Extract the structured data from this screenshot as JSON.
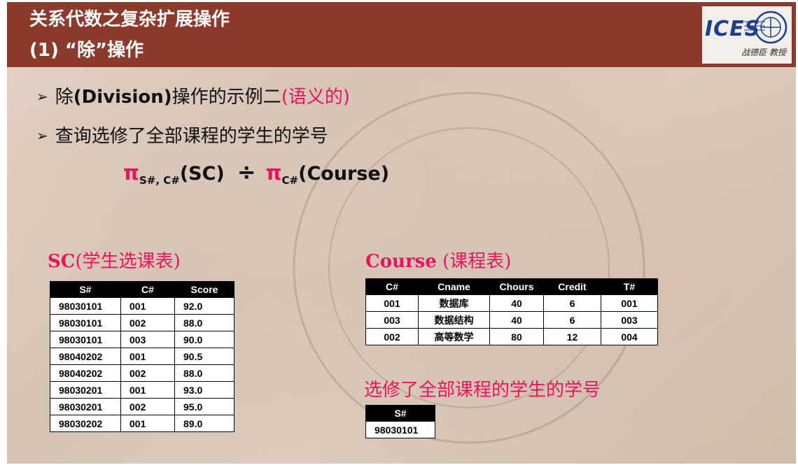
{
  "header": {
    "title_line1": "关系代数之复杂扩展操作",
    "title_line2": "(1) “除”操作",
    "logo_text": "ICES",
    "logo_caption": "战德臣 教授"
  },
  "bullets": {
    "b1_prefix": "除",
    "b1_bold": "(Division)",
    "b1_mid": "操作的示例二",
    "b1_pink": "(语义的)",
    "b2": "查询选修了全部课程的学生的学号"
  },
  "formula": {
    "pi1": "π",
    "sub1": "S#, C#",
    "arg1": "(SC)",
    "divide": "÷",
    "pi2": "π",
    "sub2": "C#",
    "arg2": "(Course)"
  },
  "sc_table": {
    "title_latin": "SC",
    "title_rest": "(学生选课表)",
    "headers": [
      "S#",
      "C#",
      "Score"
    ],
    "rows": [
      [
        "98030101",
        "001",
        "92.0"
      ],
      [
        "98030101",
        "002",
        "88.0"
      ],
      [
        "98030101",
        "003",
        "90.0"
      ],
      [
        "98040202",
        "001",
        "90.5"
      ],
      [
        "98040202",
        "002",
        "88.0"
      ],
      [
        "98030201",
        "001",
        "93.0"
      ],
      [
        "98030201",
        "002",
        "95.0"
      ],
      [
        "98030202",
        "001",
        "89.0"
      ]
    ]
  },
  "course_table": {
    "title_latin": "Course",
    "title_rest": " (课程表)",
    "headers": [
      "C#",
      "Cname",
      "Chours",
      "Credit",
      "T#"
    ],
    "rows": [
      [
        "001",
        "数据库",
        "40",
        "6",
        "001"
      ],
      [
        "003",
        "数据结构",
        "40",
        "6",
        "003"
      ],
      [
        "002",
        "高等数学",
        "80",
        "12",
        "004"
      ]
    ]
  },
  "result": {
    "title": "选修了全部课程的学生的学号",
    "headers": [
      "S#"
    ],
    "rows": [
      [
        "98030101"
      ]
    ]
  }
}
